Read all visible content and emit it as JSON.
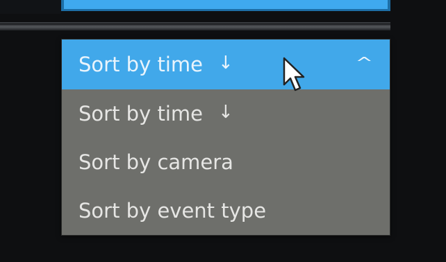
{
  "sort_dropdown": {
    "selected": {
      "label": "Sort by time",
      "icon": "arrow-down-icon",
      "arrow_glyph": "↓"
    },
    "chevron_glyph": "^",
    "options": [
      {
        "label": "Sort by time",
        "icon": "arrow-down-icon",
        "arrow_glyph": "↓"
      },
      {
        "label": "Sort by camera"
      },
      {
        "label": "Sort by event type"
      }
    ]
  },
  "colors": {
    "accent": "#41a8ea",
    "menu_background": "#6e6f6b",
    "page_background": "#0e0f11"
  }
}
